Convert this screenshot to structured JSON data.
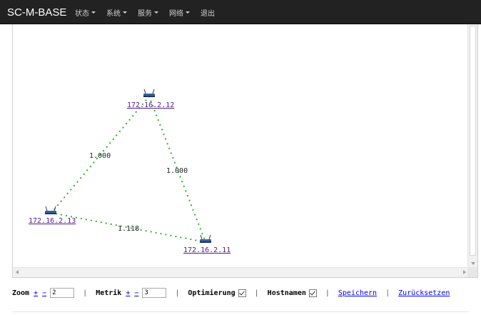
{
  "navbar": {
    "brand": "SC-M-BASE",
    "items": [
      {
        "label": "状态",
        "dropdown": true
      },
      {
        "label": "系统",
        "dropdown": true
      },
      {
        "label": "服务",
        "dropdown": true
      },
      {
        "label": "网络",
        "dropdown": true
      },
      {
        "label": "退出",
        "dropdown": false
      }
    ]
  },
  "graph": {
    "edge_color": "#2db52d",
    "nodes": [
      {
        "id": "n12",
        "label": "172.16.2.12",
        "icon": "router-icon"
      },
      {
        "id": "n13",
        "label": "172.16.2.13",
        "icon": "router-icon"
      },
      {
        "id": "n11",
        "label": "172.16.2.11",
        "icon": "router-icon"
      }
    ],
    "edges": [
      {
        "from": "n12",
        "to": "n13",
        "label": "1.000"
      },
      {
        "from": "n12",
        "to": "n11",
        "label": "1.000"
      },
      {
        "from": "n13",
        "to": "n11",
        "label": "1.118"
      }
    ]
  },
  "controls": {
    "zoom_label": "Zoom",
    "zoom_value": "2",
    "metrik_label": "Metrik",
    "metrik_value": "3",
    "plus": "+",
    "minus": "−",
    "separator": "|",
    "optimierung_label": "Optimierung",
    "optimierung_checked": true,
    "hostnamen_label": "Hostnamen",
    "hostnamen_checked": true,
    "speichern": "Speichern",
    "zuruecksetzen": "Zurücksetzen"
  }
}
